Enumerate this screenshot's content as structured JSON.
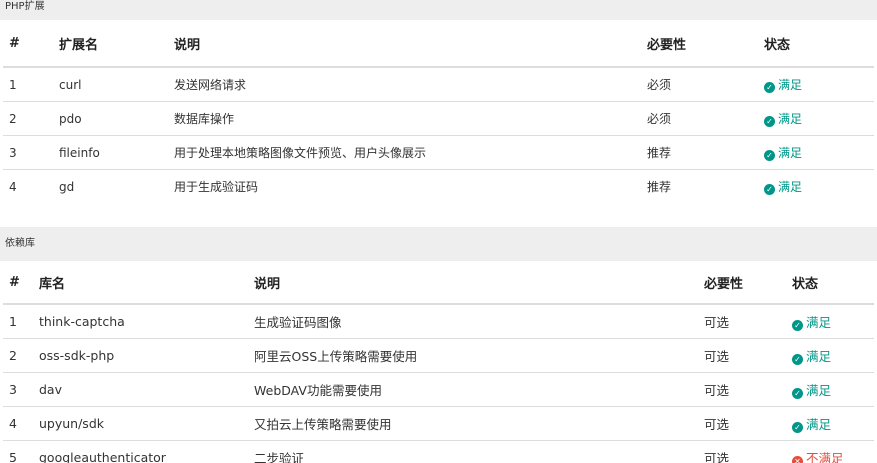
{
  "php_section": {
    "title": "PHP扩展",
    "headers": [
      "#",
      "扩展名",
      "说明",
      "必要性",
      "状态"
    ],
    "rows": [
      {
        "num": "1",
        "name": "curl",
        "desc": "发送网络请求",
        "need": "必须",
        "status": "满足",
        "ok": true
      },
      {
        "num": "2",
        "name": "pdo",
        "desc": "数据库操作",
        "need": "必须",
        "status": "满足",
        "ok": true
      },
      {
        "num": "3",
        "name": "fileinfo",
        "desc": "用于处理本地策略图像文件预览、用户头像展示",
        "need": "推荐",
        "status": "满足",
        "ok": true
      },
      {
        "num": "4",
        "name": "gd",
        "desc": "用于生成验证码",
        "need": "推荐",
        "status": "满足",
        "ok": true
      }
    ]
  },
  "dep_section": {
    "title": "依赖库",
    "headers": [
      "#",
      "库名",
      "说明",
      "必要性",
      "状态"
    ],
    "rows": [
      {
        "num": "1",
        "name": "think-captcha",
        "desc": "生成验证码图像",
        "need": "可选",
        "status": "满足",
        "ok": true
      },
      {
        "num": "2",
        "name": "oss-sdk-php",
        "desc": "阿里云OSS上传策略需要使用",
        "need": "可选",
        "status": "满足",
        "ok": true
      },
      {
        "num": "3",
        "name": "dav",
        "desc": "WebDAV功能需要使用",
        "need": "可选",
        "status": "满足",
        "ok": true
      },
      {
        "num": "4",
        "name": "upyun/sdk",
        "desc": "又拍云上传策略需要使用",
        "need": "可选",
        "status": "满足",
        "ok": true
      },
      {
        "num": "5",
        "name": "googleauthenticator",
        "desc": "二步验证",
        "need": "可选",
        "status": "不满足",
        "ok": false
      }
    ]
  },
  "colors": {
    "ok": "#009688",
    "fail": "#e74c3c",
    "heading_bg": "#eeeeee"
  },
  "icons": {
    "ok": "check-circle-icon",
    "fail": "times-circle-icon"
  }
}
